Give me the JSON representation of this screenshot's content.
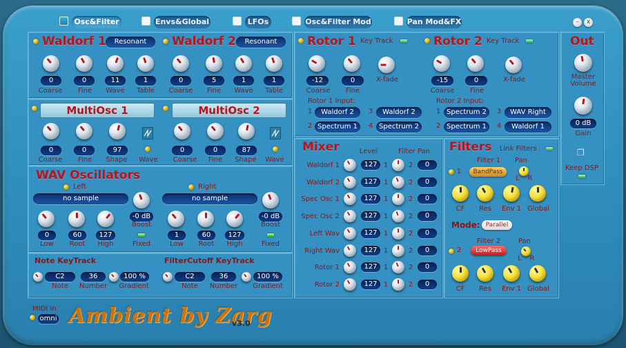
{
  "tabs": [
    {
      "label": "Osc&Filter",
      "active": true
    },
    {
      "label": "Envs&Global",
      "active": false
    },
    {
      "label": "LFOs",
      "active": false
    },
    {
      "label": "Osc&Filter Mod",
      "active": false
    },
    {
      "label": "Pan Mod&FX",
      "active": false
    }
  ],
  "window": {
    "minimize": "–",
    "close": "x"
  },
  "waldorf1": {
    "title": "Waldorf 1",
    "mode": "Resonant",
    "values": [
      "0",
      "0",
      "11",
      "1"
    ]
  },
  "waldorf2": {
    "title": "Waldorf 2",
    "mode": "Resonant",
    "values": [
      "0",
      "5",
      "1",
      "1"
    ]
  },
  "waldorf_labels": [
    "Coarse",
    "Fine",
    "Wave",
    "Table"
  ],
  "multiosc1": {
    "title": "MultiOsc 1",
    "values": [
      "0",
      "0",
      "97"
    ]
  },
  "multiosc2": {
    "title": "MultiOsc 2",
    "values": [
      "0",
      "0",
      "87"
    ]
  },
  "multiosc_labels": [
    "Coarse",
    "Fine",
    "Shape",
    "Wave"
  ],
  "wav": {
    "title": "WAV Oscillators",
    "left": {
      "label": "Left",
      "sample": "no sample",
      "boost": "-0 dB",
      "values": [
        "0",
        "60",
        "127"
      ]
    },
    "right": {
      "label": "Right",
      "sample": "no sample",
      "boost": "-0 dB",
      "values": [
        "1",
        "60",
        "127"
      ]
    },
    "knob_labels": [
      "Low",
      "Root",
      "High"
    ],
    "boost_label": "Boost",
    "fixed_label": "Fixed"
  },
  "note_keytrack": {
    "title": "Note KeyTrack",
    "note": "C2",
    "number": "36",
    "gradient": "100 %"
  },
  "filter_keytrack": {
    "title": "FilterCutoff KeyTrack",
    "note": "C2",
    "number": "36",
    "gradient": "100 %"
  },
  "keytrack_labels": [
    "Note",
    "Number",
    "Gradient"
  ],
  "rotor1": {
    "title": "Rotor 1",
    "keytrack": "Key Track",
    "values": [
      "-12",
      "0"
    ],
    "input_title": "Rotor 1 Input:",
    "inputs": [
      "Waldorf 2",
      "Spectrum 1",
      "Waldorf 2",
      "Spectrum 2"
    ]
  },
  "rotor2": {
    "title": "Rotor 2",
    "keytrack": "Key Track",
    "values": [
      "-15",
      "0"
    ],
    "input_title": "Rotor 2 Input:",
    "inputs": [
      "Spectrum 2",
      "Spectrum 1",
      "WAV Right",
      "Waldorf 1"
    ]
  },
  "rotor_labels": [
    "Coarse",
    "Fine",
    "X-fade"
  ],
  "input_nums": [
    "1",
    "2",
    "3",
    "4"
  ],
  "mixer": {
    "title": "Mixer",
    "level_header": "Level",
    "filter_pan_header": "Filter Pan",
    "rows": [
      {
        "name": "Waldorf 1",
        "level": "127",
        "pan": "0"
      },
      {
        "name": "Waldorf 2",
        "level": "127",
        "pan": "0"
      },
      {
        "name": "Spec Osc 1",
        "level": "127",
        "pan": "0"
      },
      {
        "name": "Spec Osc 2",
        "level": "127",
        "pan": "0"
      },
      {
        "name": "Left Wav",
        "level": "127",
        "pan": "0"
      },
      {
        "name": "Right Wav",
        "level": "127",
        "pan": "0"
      },
      {
        "name": "Rotor 1",
        "level": "127",
        "pan": "0"
      },
      {
        "name": "Rotor 2",
        "level": "127",
        "pan": "0"
      }
    ],
    "one": "1",
    "two": "2"
  },
  "filters": {
    "title": "Filters",
    "link": "Link Filters",
    "filter1": {
      "title": "Filter 1",
      "type": "BandPass",
      "num": "1"
    },
    "filter2": {
      "title": "Filter 2",
      "type": "LowPass",
      "num": "2"
    },
    "pan": "Pan",
    "l": "L",
    "r": "R",
    "mode_label": "Mode:",
    "mode": "Parallel",
    "knob_labels": [
      "CF",
      "Res",
      "Env 1",
      "Global"
    ]
  },
  "out": {
    "title": "Out",
    "master": "Master Volume",
    "gain_value": "0 dB",
    "gain": "Gain",
    "keep_dsp": "Keep DSP"
  },
  "midi": {
    "label": "MIDI In",
    "channel": "omni"
  },
  "logo": "Ambient by Zarg",
  "version": "v3.0"
}
